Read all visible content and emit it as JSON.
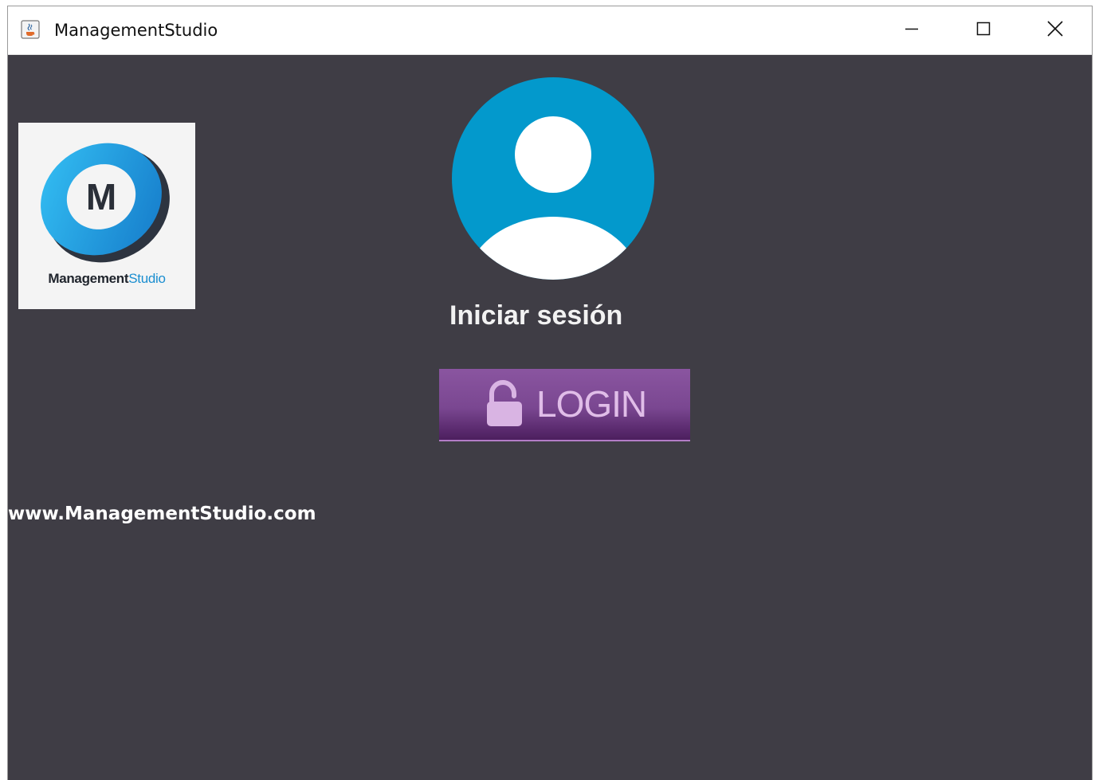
{
  "window": {
    "title": "ManagementStudio",
    "app_icon": "java-cup-icon",
    "controls": [
      "minimize-icon",
      "maximize-icon",
      "close-icon"
    ]
  },
  "logo": {
    "letter": "M",
    "wordmark": "Management",
    "wordmark_accent": "Studio",
    "colors": {
      "ring": "#1a9fe0",
      "ring_dark": "#2d3440",
      "card": "#f4f4f4"
    }
  },
  "avatar": {
    "icon": "user-avatar-icon",
    "color": "#0399cc"
  },
  "login": {
    "heading": "Iniciar sesión",
    "button_label": "LOGIN",
    "button_icon": "unlock-icon",
    "button_color": "#7a4791"
  },
  "footer": {
    "website": "www.ManagementStudio.com"
  },
  "theme": {
    "background": "#3f3d45"
  }
}
